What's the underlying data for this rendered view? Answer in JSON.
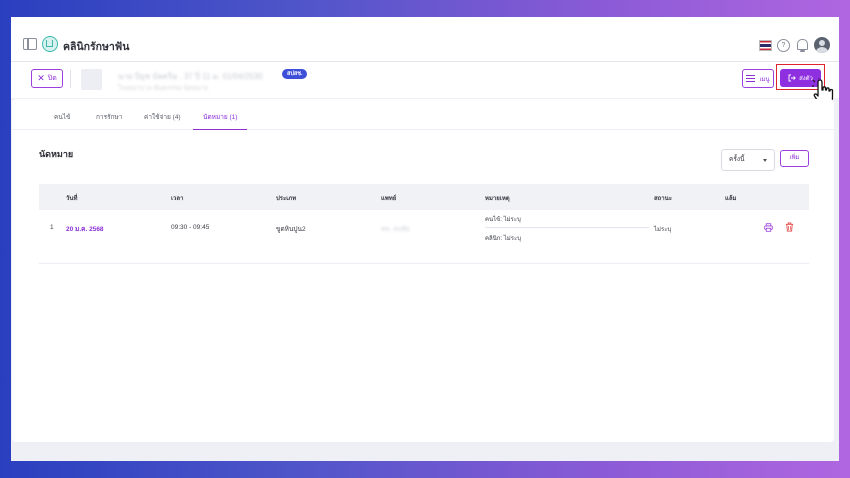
{
  "app": {
    "title": "คลินิกรักษาฟัน"
  },
  "header": {
    "icons": [
      "sidebar-toggle-icon",
      "clinic-logo-icon",
      "thai-flag-icon",
      "help-icon",
      "bell-icon",
      "avatar"
    ]
  },
  "patient": {
    "close_label": "ปิด",
    "name": "นาย ปิยุช บัลคริษ . 37 ปี 11 ม. 01/04/2530",
    "sub": "โรงพยาบาล ทันตกรรม นัดหมาย",
    "badge": "สปสช.",
    "menu_label": "เมนู",
    "send_label": "ส่งตัว"
  },
  "tabs": [
    {
      "label": "คนไข้"
    },
    {
      "label": "การรักษา"
    },
    {
      "label": "ค่าใช้จ่าย (4)"
    },
    {
      "label": "นัดหมาย (1)"
    }
  ],
  "appointments": {
    "title": "นัดหมาย",
    "filter_value": "ครั้งนี้",
    "add_label": "เพิ่ม",
    "columns": [
      "วันที่",
      "เวลา",
      "ประเภท",
      "แพทย์",
      "หมายเหตุ",
      "สถานะ",
      "แล้ม"
    ],
    "rows": [
      {
        "index": "1",
        "date": "20 ม.ค. 2568",
        "time": "09:30 - 09:45",
        "type": "ขูดหินปูน2",
        "doctor": "ทพ. สมชัย",
        "note_patient": "คนไข้: ไม่ระบุ",
        "note_clinic": "คลินิก: ไม่ระบุ",
        "status": "ไม่ระบุ"
      }
    ]
  },
  "colors": {
    "accent": "#8c2fd6",
    "badge": "#3d4fd8",
    "highlight": "#e0242f"
  }
}
